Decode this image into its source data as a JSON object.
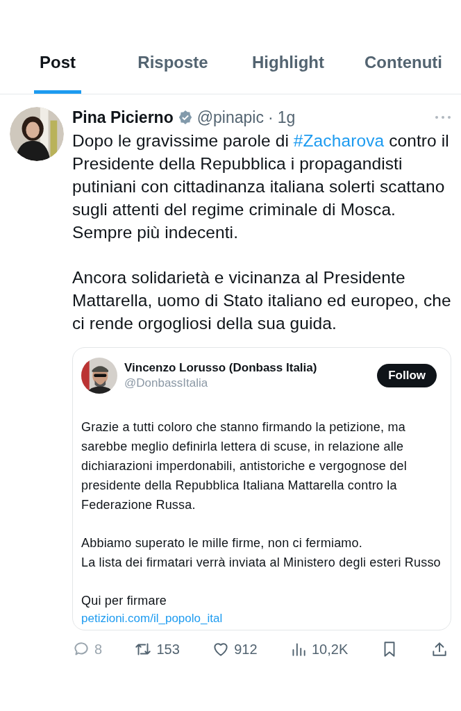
{
  "tabs": [
    {
      "label": "Post",
      "selected": true
    },
    {
      "label": "Risposte",
      "selected": false
    },
    {
      "label": "Highlight",
      "selected": false
    },
    {
      "label": "Contenuti",
      "selected": false
    }
  ],
  "post": {
    "author": "Pina Picierno",
    "verified": true,
    "handle": "@pinapic",
    "separator": "·",
    "time": "1g",
    "paragraphs": [
      [
        [
          {
            "text": "Dopo le gravissime parole di "
          },
          {
            "text": "#Zacharova",
            "kind": "hashtag"
          },
          {
            "text": " contro il Presidente della Repubblica i propagandisti putiniani con cittadinanza italiana solerti scattano sugli attenti del regime criminale di Mosca."
          }
        ],
        [
          {
            "text": "Sempre più indecenti."
          }
        ]
      ],
      [
        [
          {
            "text": "Ancora solidarietà e vicinanza al Presidente Mattarella, uomo di Stato italiano ed europeo, che ci rende orgogliosi della sua guida."
          }
        ]
      ]
    ],
    "quote": {
      "author": "Vincenzo Lorusso (Donbass Italia)",
      "handle": "@DonbassItalia",
      "follow": "Follow",
      "paragraphs": [
        [
          "Grazie a tutti coloro che stanno firmando la petizione,  ma sarebbe meglio definirla lettera di scuse, in relazione alle dichiarazioni imperdonabili, antistoriche e vergognose del presidente della Repubblica Italiana Mattarella contro la Federazione Russa."
        ],
        [
          "Abbiamo superato le mille firme, non ci fermiamo.",
          "La lista dei firmatari verrà inviata al Ministero degli esteri Russo"
        ],
        [
          "Qui per firmare"
        ]
      ],
      "link": "petizioni.com/il_popolo_ital"
    },
    "actions": [
      {
        "kind": "reply",
        "count": "8",
        "disabled": true
      },
      {
        "kind": "repost",
        "count": "153",
        "disabled": false
      },
      {
        "kind": "like",
        "count": "912",
        "disabled": false
      },
      {
        "kind": "views",
        "count": "10,2K",
        "disabled": false
      },
      {
        "kind": "bookmark",
        "disabled": false
      },
      {
        "kind": "share",
        "disabled": false
      }
    ]
  }
}
